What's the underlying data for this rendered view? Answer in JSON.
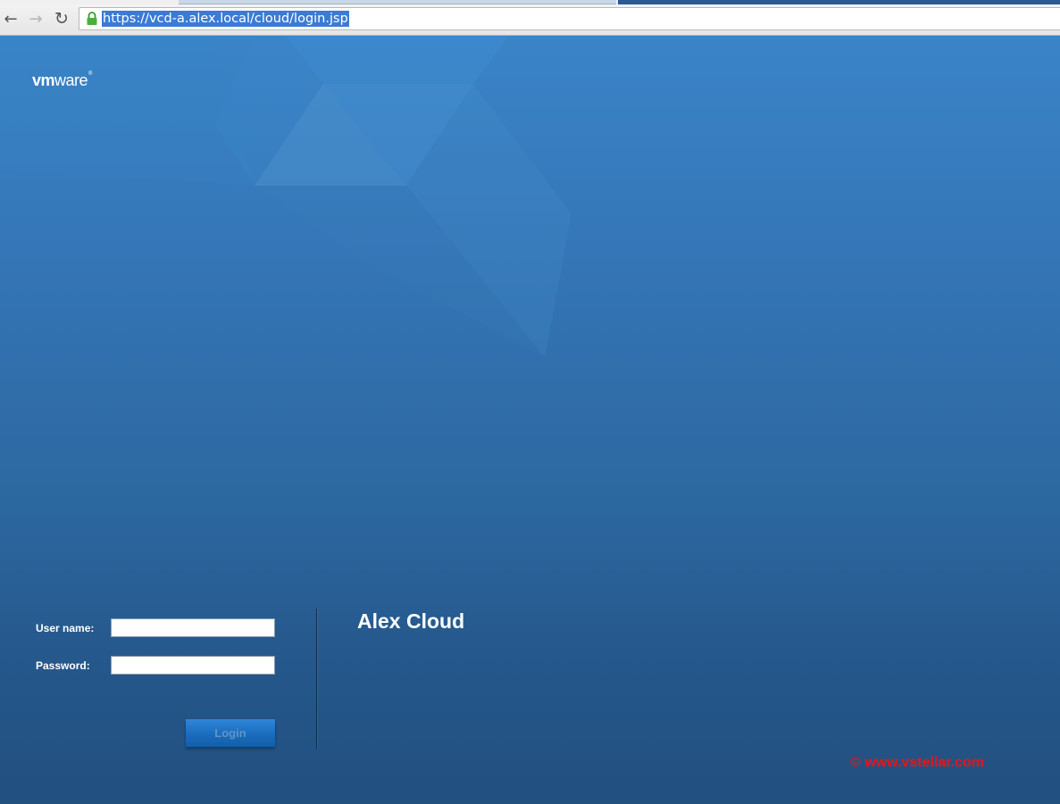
{
  "browser": {
    "url": "https://vcd-a.alex.local/cloud/login.jsp",
    "icons": {
      "back": "back-arrow-icon",
      "forward": "forward-arrow-icon",
      "reload": "reload-icon",
      "lock": "lock-icon"
    }
  },
  "page": {
    "brand_logo": "vmware",
    "colors": {
      "background_top": "#3a84c7",
      "background_bottom": "#22507f",
      "watermark": "#e8141a"
    }
  },
  "login": {
    "username_label": "User name:",
    "username_value": "",
    "password_label": "Password:",
    "password_value": "",
    "login_button": "Login"
  },
  "org_title": "Alex Cloud",
  "watermark": "© www.vstellar.com"
}
